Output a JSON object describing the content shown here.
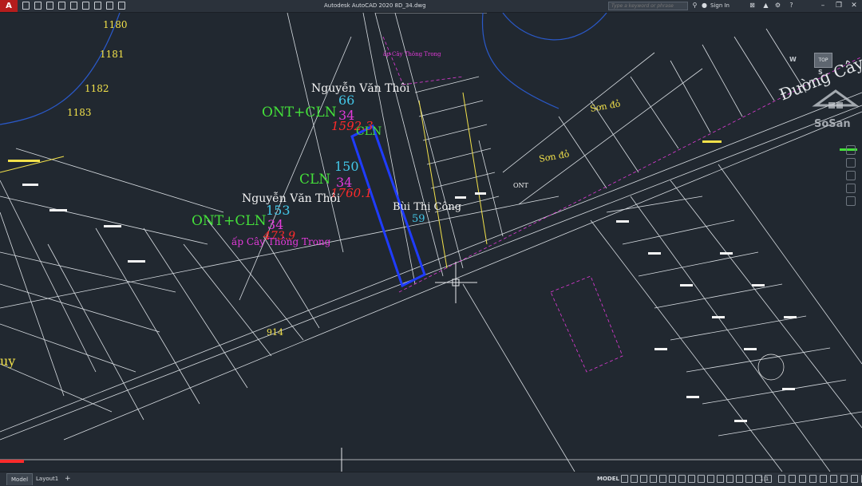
{
  "app": {
    "logo_letter": "A",
    "window_title": "Autodesk AutoCAD 2020    8D_34.dwg",
    "search_placeholder": "Type a keyword or phrase",
    "sign_in": "Sign In"
  },
  "drawing": {
    "contour_labels": [
      "1180",
      "1181",
      "1182",
      "1183"
    ],
    "road_name": "Đường Cây",
    "parcel_a": {
      "owner": "Nguyễn Văn Thôi",
      "land_use": "ONT+CLN",
      "number": "66",
      "sheet": "34",
      "area": "1592.3"
    },
    "parcel_b": {
      "owner": "Bùi Thị Công",
      "land_use": "CLN",
      "number": "150",
      "sheet": "34",
      "area": "1760.1",
      "extra": "CLN"
    },
    "parcel_c": {
      "owner": "Nguyễn Văn Thôi",
      "land_use": "ONT+CLN",
      "number": "153",
      "sheet": "34",
      "area": "473.9",
      "hamlet": "ấp Cây Thông Trong"
    },
    "hamlet_label_small": "ấp Cây Thông Trong",
    "son_do_1": "Sơn đỏ",
    "son_do_2": "Sơn đỏ",
    "ont_label": "ONT",
    "area_914": "914",
    "area_59": "59",
    "left_partial": "uy"
  },
  "watermark": {
    "text": "SoSan"
  },
  "viewcube": {
    "top": "TOP",
    "w": "W",
    "s": "S"
  },
  "status": {
    "tabs": [
      "Model",
      "Layout1",
      "+"
    ],
    "model_button": "MODEL",
    "scale": "1:1"
  },
  "colors": {
    "background": "#212830",
    "selection": "#1f3cff",
    "cln_green": "#44e03a",
    "magenta": "#e23ad9",
    "red": "#ff2b2b",
    "cyan": "#43c7e8",
    "yellow": "#f2e14a"
  }
}
